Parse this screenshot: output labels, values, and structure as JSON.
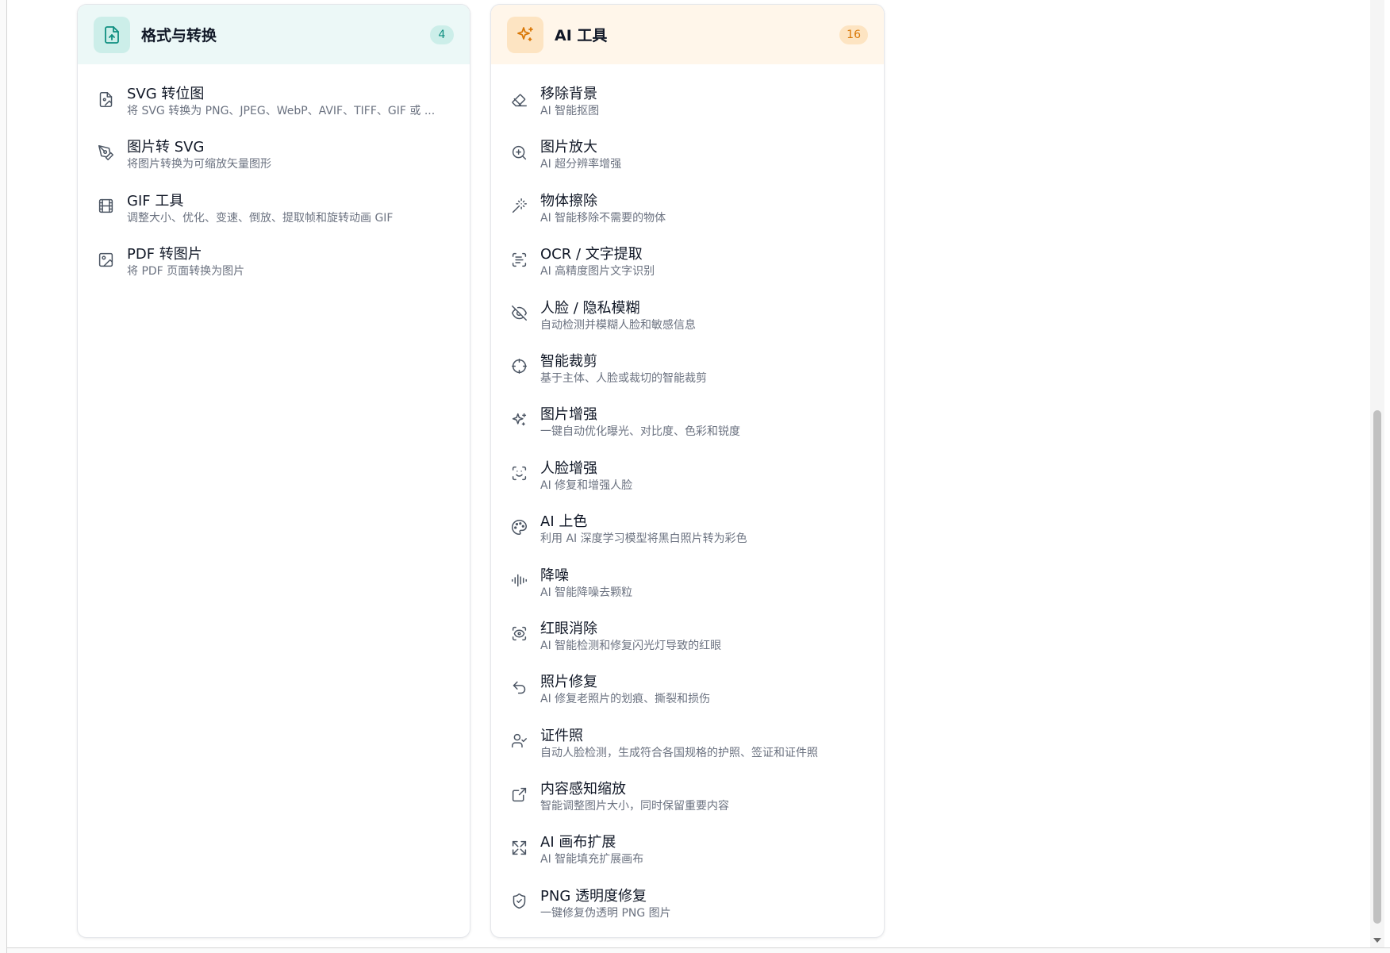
{
  "format_card": {
    "title": "格式与转换",
    "count": "4",
    "header_icon": "file-upload-icon",
    "color": "#0f8f80",
    "items": [
      {
        "icon": "file-image-icon",
        "title": "SVG 转位图",
        "desc": "将 SVG 转换为 PNG、JPEG、WebP、AVIF、TIFF、GIF 或 ..."
      },
      {
        "icon": "pen-tool-icon",
        "title": "图片转 SVG",
        "desc": "将图片转换为可缩放矢量图形"
      },
      {
        "icon": "film-icon",
        "title": "GIF 工具",
        "desc": "调整大小、优化、变速、倒放、提取帧和旋转动画 GIF"
      },
      {
        "icon": "image-square-icon",
        "title": "PDF 转图片",
        "desc": "将 PDF 页面转换为图片"
      }
    ]
  },
  "ai_card": {
    "title": "AI 工具",
    "count": "16",
    "header_icon": "sparkles-icon",
    "color": "#d97706",
    "items": [
      {
        "icon": "eraser-icon",
        "title": "移除背景",
        "desc": "AI 智能抠图"
      },
      {
        "icon": "zoom-in-icon",
        "title": "图片放大",
        "desc": "AI 超分辨率增强"
      },
      {
        "icon": "magic-wand-icon",
        "title": "物体擦除",
        "desc": "AI 智能移除不需要的物体"
      },
      {
        "icon": "scan-text-icon",
        "title": "OCR / 文字提取",
        "desc": "AI 高精度图片文字识别"
      },
      {
        "icon": "eye-off-icon",
        "title": "人脸 / 隐私模糊",
        "desc": "自动检测并模糊人脸和敏感信息"
      },
      {
        "icon": "crosshair-icon",
        "title": "智能裁剪",
        "desc": "基于主体、人脸或裁切的智能裁剪"
      },
      {
        "icon": "sparkles-icon",
        "title": "图片增强",
        "desc": "一键自动优化曝光、对比度、色彩和锐度"
      },
      {
        "icon": "scan-face-icon",
        "title": "人脸增强",
        "desc": "AI 修复和增强人脸"
      },
      {
        "icon": "palette-icon",
        "title": "AI 上色",
        "desc": "利用 AI 深度学习模型将黑白照片转为彩色"
      },
      {
        "icon": "audio-waveform-icon",
        "title": "降噪",
        "desc": "AI 智能降噪去颗粒"
      },
      {
        "icon": "scan-eye-icon",
        "title": "红眼消除",
        "desc": "AI 智能检测和修复闪光灯导致的红眼"
      },
      {
        "icon": "undo-icon",
        "title": "照片修复",
        "desc": "AI 修复老照片的划痕、撕裂和损伤"
      },
      {
        "icon": "user-check-icon",
        "title": "证件照",
        "desc": "自动人脸检测，生成符合各国规格的护照、签证和证件照"
      },
      {
        "icon": "external-resize-icon",
        "title": "内容感知缩放",
        "desc": "智能调整图片大小，同时保留重要内容"
      },
      {
        "icon": "expand-icon",
        "title": "AI 画布扩展",
        "desc": "AI 智能填充扩展画布"
      },
      {
        "icon": "shield-check-icon",
        "title": "PNG 透明度修复",
        "desc": "一键修复伪透明 PNG 图片"
      }
    ]
  }
}
